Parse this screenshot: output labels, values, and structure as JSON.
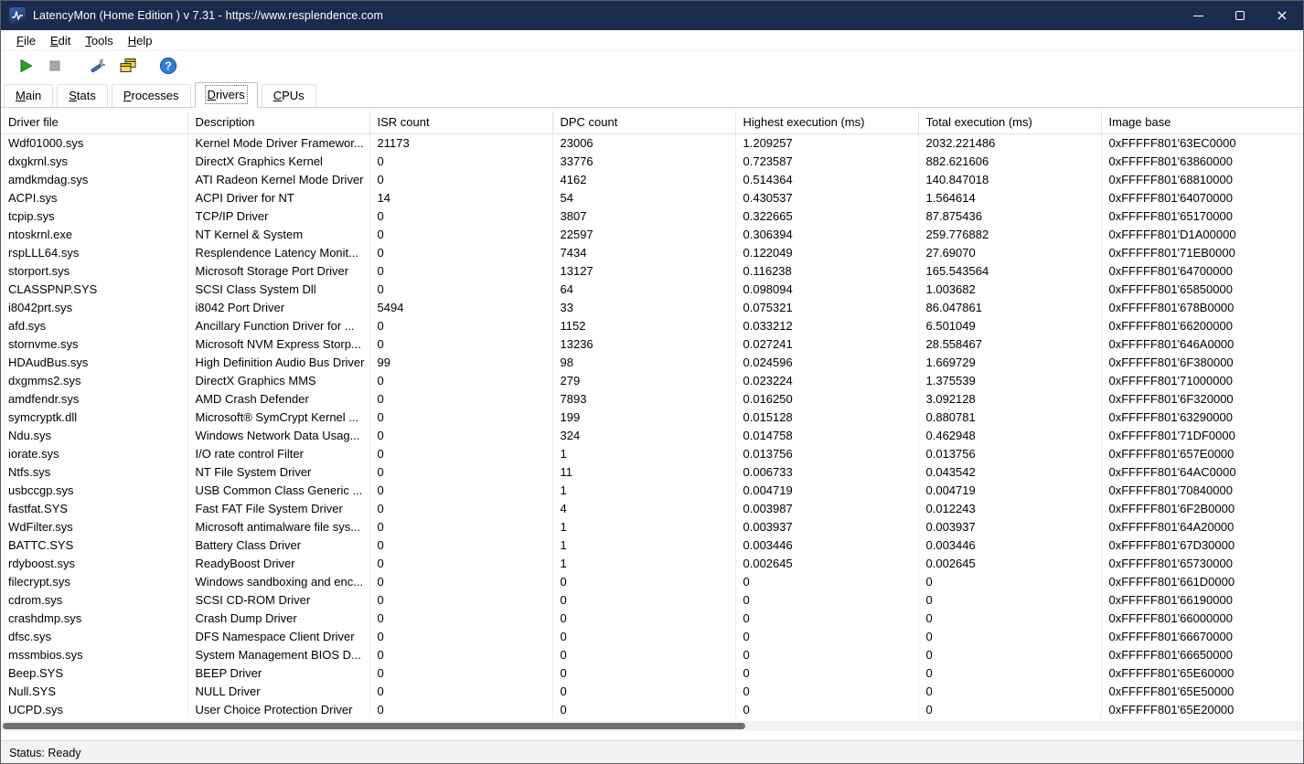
{
  "window": {
    "title": "LatencyMon  (Home Edition )  v 7.31 - https://www.resplendence.com"
  },
  "colors": {
    "titlebar": "#1b2b4d",
    "play_green": "#22a322",
    "stop_gray": "#a8a8a8",
    "windows_yellow": "#ffd94d",
    "help_blue": "#2f7be0"
  },
  "menu_bar": {
    "items": [
      {
        "label": "File"
      },
      {
        "label": "Edit"
      },
      {
        "label": "Tools"
      },
      {
        "label": "Help"
      }
    ]
  },
  "toolbar": {
    "buttons": [
      {
        "name": "start-monitor",
        "icon": "play-icon"
      },
      {
        "name": "stop-monitor",
        "icon": "stop-icon",
        "disabled": true
      },
      {
        "name": "tools-options",
        "icon": "wrench-icon"
      },
      {
        "name": "windows",
        "icon": "stacked-windows-icon"
      },
      {
        "name": "help",
        "icon": "help-icon"
      }
    ]
  },
  "tabs": [
    {
      "label": "Main",
      "selected": false
    },
    {
      "label": "Stats",
      "selected": false
    },
    {
      "label": "Processes",
      "selected": false
    },
    {
      "label": "Drivers",
      "selected": true
    },
    {
      "label": "CPUs",
      "selected": false
    }
  ],
  "table": {
    "columns": [
      "Driver file",
      "Description",
      "ISR count",
      "DPC count",
      "Highest execution (ms)",
      "Total execution (ms)",
      "Image base"
    ],
    "rows": [
      [
        "Wdf01000.sys",
        "Kernel Mode Driver Framewor...",
        "21173",
        "23006",
        "1.209257",
        "2032.221486",
        "0xFFFFF801'63EC0000"
      ],
      [
        "dxgkrnl.sys",
        "DirectX Graphics Kernel",
        "0",
        "33776",
        "0.723587",
        "882.621606",
        "0xFFFFF801'63860000"
      ],
      [
        "amdkmdag.sys",
        "ATI Radeon Kernel Mode Driver",
        "0",
        "4162",
        "0.514364",
        "140.847018",
        "0xFFFFF801'68810000"
      ],
      [
        "ACPI.sys",
        "ACPI Driver for NT",
        "14",
        "54",
        "0.430537",
        "1.564614",
        "0xFFFFF801'64070000"
      ],
      [
        "tcpip.sys",
        "TCP/IP Driver",
        "0",
        "3807",
        "0.322665",
        "87.875436",
        "0xFFFFF801'65170000"
      ],
      [
        "ntoskrnl.exe",
        "NT Kernel & System",
        "0",
        "22597",
        "0.306394",
        "259.776882",
        "0xFFFFF801'D1A00000"
      ],
      [
        "rspLLL64.sys",
        "Resplendence Latency Monit...",
        "0",
        "7434",
        "0.122049",
        "27.69070",
        "0xFFFFF801'71EB0000"
      ],
      [
        "storport.sys",
        "Microsoft Storage Port Driver",
        "0",
        "13127",
        "0.116238",
        "165.543564",
        "0xFFFFF801'64700000"
      ],
      [
        "CLASSPNP.SYS",
        "SCSI Class System Dll",
        "0",
        "64",
        "0.098094",
        "1.003682",
        "0xFFFFF801'65850000"
      ],
      [
        "i8042prt.sys",
        "i8042 Port Driver",
        "5494",
        "33",
        "0.075321",
        "86.047861",
        "0xFFFFF801'678B0000"
      ],
      [
        "afd.sys",
        "Ancillary Function Driver for ...",
        "0",
        "1152",
        "0.033212",
        "6.501049",
        "0xFFFFF801'66200000"
      ],
      [
        "stornvme.sys",
        "Microsoft NVM Express Storp...",
        "0",
        "13236",
        "0.027241",
        "28.558467",
        "0xFFFFF801'646A0000"
      ],
      [
        "HDAudBus.sys",
        "High Definition Audio Bus Driver",
        "99",
        "98",
        "0.024596",
        "1.669729",
        "0xFFFFF801'6F380000"
      ],
      [
        "dxgmms2.sys",
        "DirectX Graphics MMS",
        "0",
        "279",
        "0.023224",
        "1.375539",
        "0xFFFFF801'71000000"
      ],
      [
        "amdfendr.sys",
        "AMD Crash Defender",
        "0",
        "7893",
        "0.016250",
        "3.092128",
        "0xFFFFF801'6F320000"
      ],
      [
        "symcryptk.dll",
        "Microsoft® SymCrypt Kernel ...",
        "0",
        "199",
        "0.015128",
        "0.880781",
        "0xFFFFF801'63290000"
      ],
      [
        "Ndu.sys",
        "Windows Network Data Usag...",
        "0",
        "324",
        "0.014758",
        "0.462948",
        "0xFFFFF801'71DF0000"
      ],
      [
        "iorate.sys",
        "I/O rate control Filter",
        "0",
        "1",
        "0.013756",
        "0.013756",
        "0xFFFFF801'657E0000"
      ],
      [
        "Ntfs.sys",
        "NT File System Driver",
        "0",
        "11",
        "0.006733",
        "0.043542",
        "0xFFFFF801'64AC0000"
      ],
      [
        "usbccgp.sys",
        "USB Common Class Generic ...",
        "0",
        "1",
        "0.004719",
        "0.004719",
        "0xFFFFF801'70840000"
      ],
      [
        "fastfat.SYS",
        "Fast FAT File System Driver",
        "0",
        "4",
        "0.003987",
        "0.012243",
        "0xFFFFF801'6F2B0000"
      ],
      [
        "WdFilter.sys",
        "Microsoft antimalware file sys...",
        "0",
        "1",
        "0.003937",
        "0.003937",
        "0xFFFFF801'64A20000"
      ],
      [
        "BATTC.SYS",
        "Battery Class Driver",
        "0",
        "1",
        "0.003446",
        "0.003446",
        "0xFFFFF801'67D30000"
      ],
      [
        "rdyboost.sys",
        "ReadyBoost Driver",
        "0",
        "1",
        "0.002645",
        "0.002645",
        "0xFFFFF801'65730000"
      ],
      [
        "filecrypt.sys",
        "Windows sandboxing and enc...",
        "0",
        "0",
        "0",
        "0",
        "0xFFFFF801'661D0000"
      ],
      [
        "cdrom.sys",
        "SCSI CD-ROM Driver",
        "0",
        "0",
        "0",
        "0",
        "0xFFFFF801'66190000"
      ],
      [
        "crashdmp.sys",
        "Crash Dump Driver",
        "0",
        "0",
        "0",
        "0",
        "0xFFFFF801'66000000"
      ],
      [
        "dfsc.sys",
        "DFS Namespace Client Driver",
        "0",
        "0",
        "0",
        "0",
        "0xFFFFF801'66670000"
      ],
      [
        "mssmbios.sys",
        "System Management BIOS D...",
        "0",
        "0",
        "0",
        "0",
        "0xFFFFF801'66650000"
      ],
      [
        "Beep.SYS",
        "BEEP Driver",
        "0",
        "0",
        "0",
        "0",
        "0xFFFFF801'65E60000"
      ],
      [
        "Null.SYS",
        "NULL Driver",
        "0",
        "0",
        "0",
        "0",
        "0xFFFFF801'65E50000"
      ],
      [
        "UCPD.sys",
        "User Choice Protection Driver",
        "0",
        "0",
        "0",
        "0",
        "0xFFFFF801'65E20000"
      ]
    ]
  },
  "scrollbar": {
    "orientation": "horizontal",
    "thumb_fraction": 0.57
  },
  "status_bar": {
    "text": "Status: Ready"
  }
}
